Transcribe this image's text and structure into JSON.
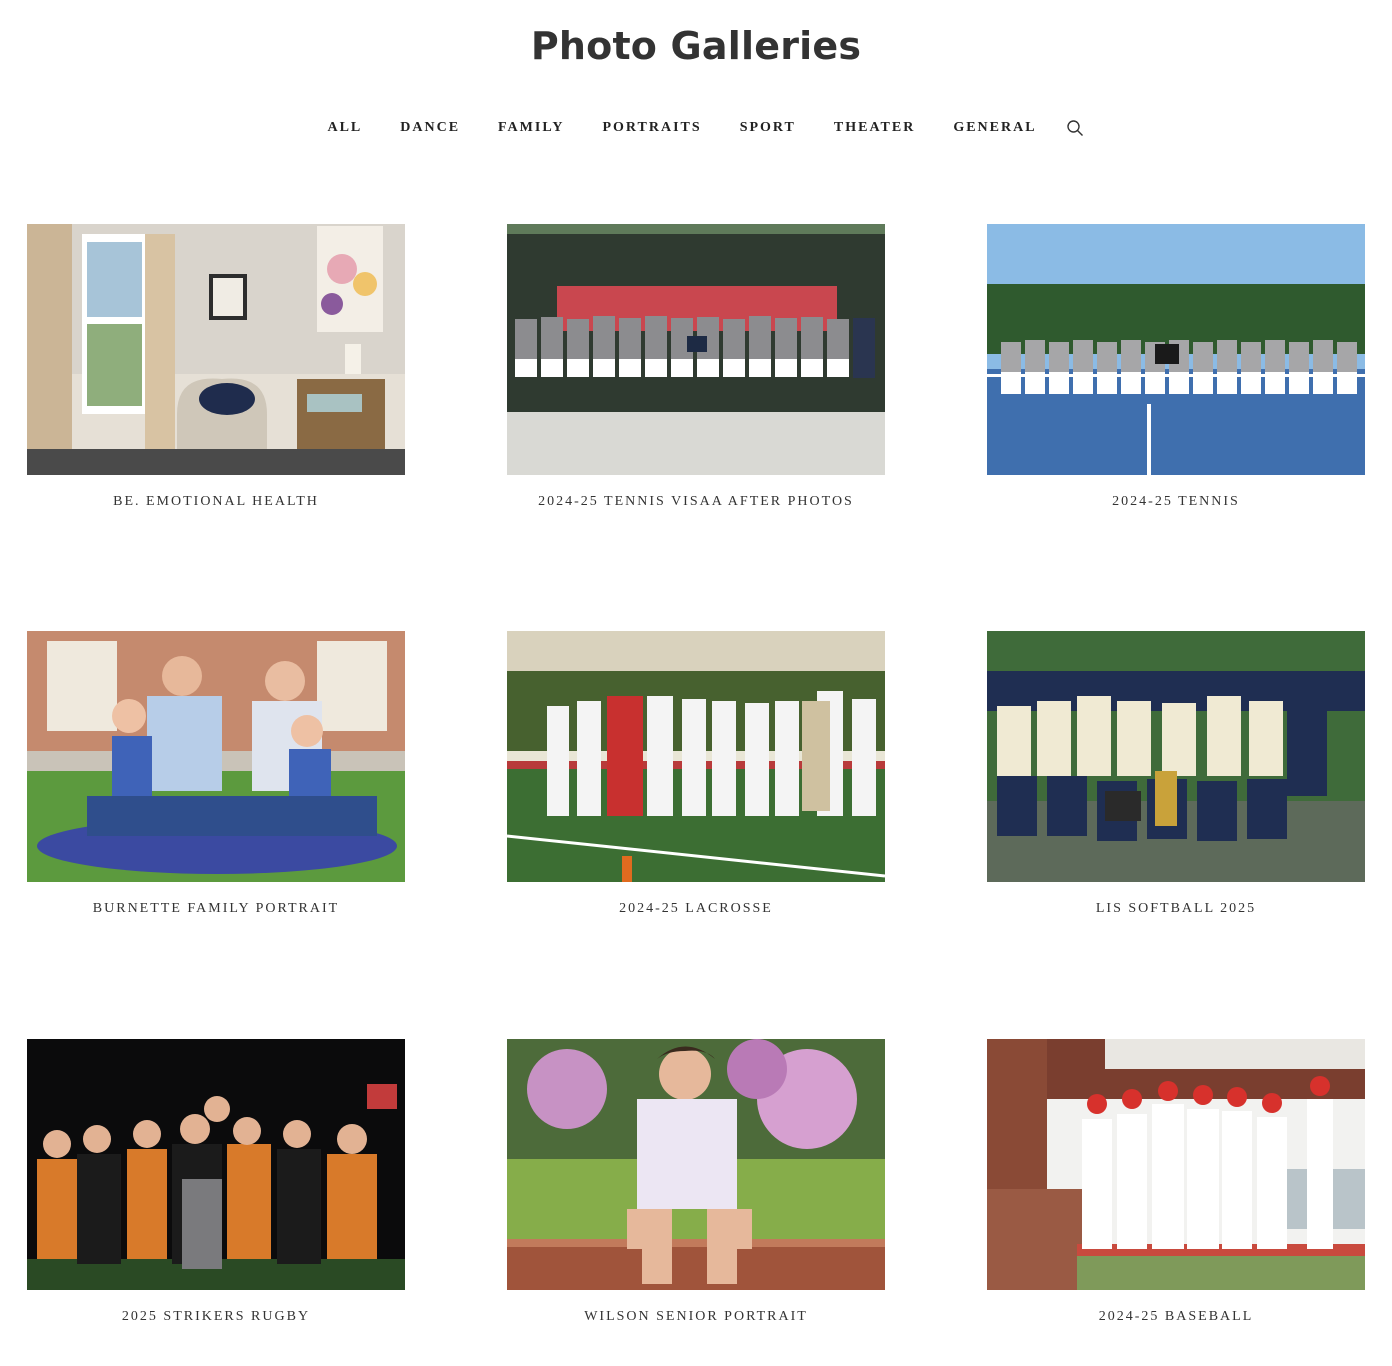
{
  "page": {
    "title": "Photo Galleries"
  },
  "nav": {
    "items": [
      "ALL",
      "DANCE",
      "FAMILY",
      "PORTRAITS",
      "SPORT",
      "THEATER",
      "GENERAL"
    ],
    "search_icon": "search-icon"
  },
  "galleries": [
    {
      "caption": "BE. EMOTIONAL HEALTH",
      "scene": "room-interior"
    },
    {
      "caption": "2024-25 TENNIS VISAA AFTER PHOTOS",
      "scene": "tennis-team-fence"
    },
    {
      "caption": "2024-25 TENNIS",
      "scene": "tennis-team-court"
    },
    {
      "caption": "BURNETTE FAMILY PORTRAIT",
      "scene": "family-on-grass"
    },
    {
      "caption": "2024-25 LACROSSE",
      "scene": "lacrosse-huddle"
    },
    {
      "caption": "LIS SOFTBALL 2025",
      "scene": "softball-team"
    },
    {
      "caption": "2025 STRIKERS RUGBY",
      "scene": "rugby-night"
    },
    {
      "caption": "WILSON SENIOR PORTRAIT",
      "scene": "senior-portrait"
    },
    {
      "caption": "2024-25 BASEBALL",
      "scene": "baseball-celebration"
    }
  ]
}
